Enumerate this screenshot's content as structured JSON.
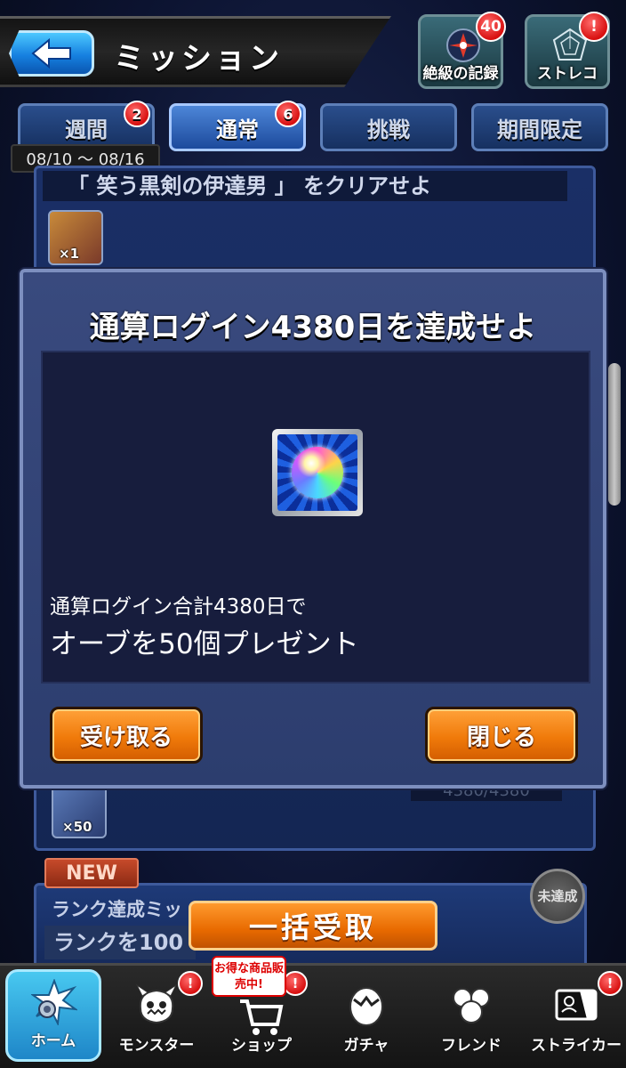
{
  "header": {
    "title": "ミッション",
    "records_label": "絶級の記録",
    "records_badge": "40",
    "storeco_label": "ストレコ",
    "storeco_badge": "!"
  },
  "tabs": [
    {
      "label": "週間",
      "badge": "2",
      "active": false
    },
    {
      "label": "通常",
      "badge": "6",
      "active": true
    },
    {
      "label": "挑戦",
      "badge": "",
      "active": false
    },
    {
      "label": "期間限定",
      "badge": "",
      "active": false
    }
  ],
  "date_range": "08/10 ～ 08/16",
  "background_list": {
    "mission_title": "「 笑う黒剣の伊達男 」 をクリアせよ",
    "reward1_count": "×1",
    "reward2_count": "×50",
    "progress_text": "4380/4380",
    "new_tag": "NEW",
    "card2_title": "ランク達成ミッ",
    "card2_subtitle": "ランクを100",
    "bulk_receive_label": "一括受取",
    "status_label": "未達成"
  },
  "modal": {
    "title": "通算ログイン4380日を達成せよ",
    "description_line1": "通算ログイン合計4380日で",
    "description_line2": "オーブを50個プレゼント",
    "reward_icon": "rainbow-orb-icon",
    "receive_label": "受け取る",
    "close_label": "閉じる"
  },
  "bottom_nav": {
    "items": [
      {
        "label": "ホーム",
        "icon": "home-icon",
        "badge": ""
      },
      {
        "label": "モンスター",
        "icon": "monster-icon",
        "badge": "!"
      },
      {
        "label": "ショップ",
        "icon": "shop-cart-icon",
        "badge": "!"
      },
      {
        "label": "ガチャ",
        "icon": "gacha-egg-icon",
        "badge": ""
      },
      {
        "label": "フレンド",
        "icon": "friend-icon",
        "badge": ""
      },
      {
        "label": "ストライカー",
        "icon": "striker-card-icon",
        "badge": "!"
      }
    ],
    "shop_promo": "お得な商品販売中!"
  },
  "colors": {
    "accent_orange": "#f07a0a",
    "modal_bg": "#394a7e",
    "tab_active": "#4d86d8",
    "badge_red": "#d81010"
  }
}
